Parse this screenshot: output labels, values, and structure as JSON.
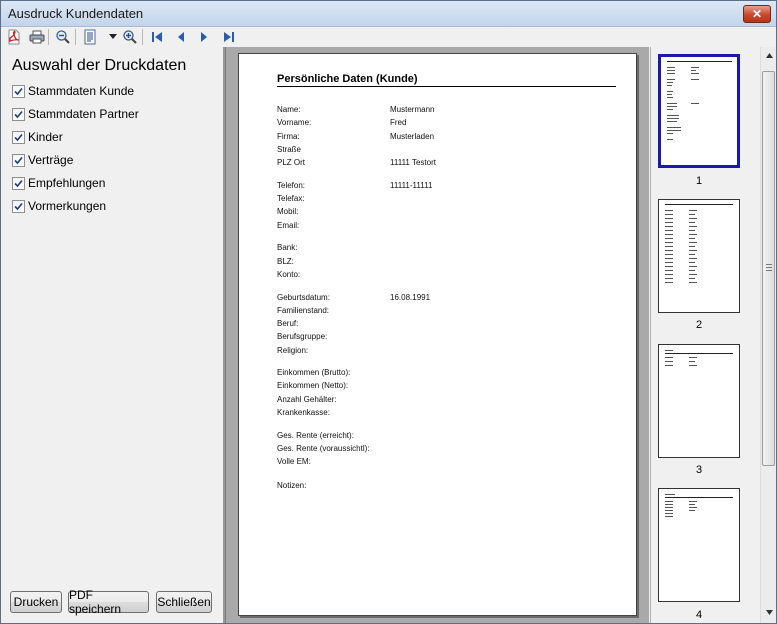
{
  "window": {
    "title": "Ausdruck Kundendaten",
    "close_symbol": "✕"
  },
  "toolbar": {
    "icons": [
      "pdf-icon",
      "print-icon",
      "zoom-out-icon",
      "page-layout-icon",
      "dropdown-arrow-icon",
      "zoom-in-icon",
      "first-page-icon",
      "previous-page-icon",
      "next-page-icon",
      "last-page-icon"
    ]
  },
  "left_panel": {
    "title": "Auswahl der Druckdaten",
    "options": [
      {
        "label": "Stammdaten Kunde",
        "checked": true
      },
      {
        "label": "Stammdaten Partner",
        "checked": true
      },
      {
        "label": "Kinder",
        "checked": true
      },
      {
        "label": "Verträge",
        "checked": true
      },
      {
        "label": "Empfehlungen",
        "checked": true
      },
      {
        "label": "Vormerkungen",
        "checked": true
      }
    ],
    "buttons": {
      "print": "Drucken",
      "save_pdf": "PDF speichern",
      "close": "Schließen"
    }
  },
  "document": {
    "title": "Persönliche Daten (Kunde)",
    "fields": [
      {
        "label": "Name:",
        "value": "Mustermann"
      },
      {
        "label": "Vorname:",
        "value": "Fred"
      },
      {
        "label": "Firma:",
        "value": "Musterladen"
      },
      {
        "label": "Straße",
        "value": ""
      },
      {
        "label": "PLZ Ort",
        "value": "11111 Testort"
      },
      {
        "label": "Telefon:",
        "value": "11111-11111"
      },
      {
        "label": "Telefax:",
        "value": ""
      },
      {
        "label": "Mobil:",
        "value": ""
      },
      {
        "label": "Email:",
        "value": ""
      },
      {
        "label": "Bank:",
        "value": ""
      },
      {
        "label": "BLZ:",
        "value": ""
      },
      {
        "label": "Konto:",
        "value": ""
      },
      {
        "label": "Geburtsdatum:",
        "value": "16.08.1991"
      },
      {
        "label": "Familienstand:",
        "value": ""
      },
      {
        "label": "Beruf:",
        "value": ""
      },
      {
        "label": "Berufsgruppe:",
        "value": ""
      },
      {
        "label": "Religion:",
        "value": ""
      },
      {
        "label": "Einkommen (Brutto):",
        "value": ""
      },
      {
        "label": "Einkommen (Netto):",
        "value": ""
      },
      {
        "label": "Anzahl Gehälter:",
        "value": ""
      },
      {
        "label": "Krankenkasse:",
        "value": ""
      },
      {
        "label": "Ges. Rente (erreicht):",
        "value": ""
      },
      {
        "label": "Ges. Rente (voraussichtl):",
        "value": ""
      },
      {
        "label": "Volle EM:",
        "value": ""
      },
      {
        "label": "Notizen:",
        "value": ""
      }
    ]
  },
  "thumbnails": {
    "pages": [
      {
        "number": "1",
        "selected": true
      },
      {
        "number": "2",
        "selected": false
      },
      {
        "number": "3",
        "selected": false
      },
      {
        "number": "4",
        "selected": false
      }
    ]
  }
}
